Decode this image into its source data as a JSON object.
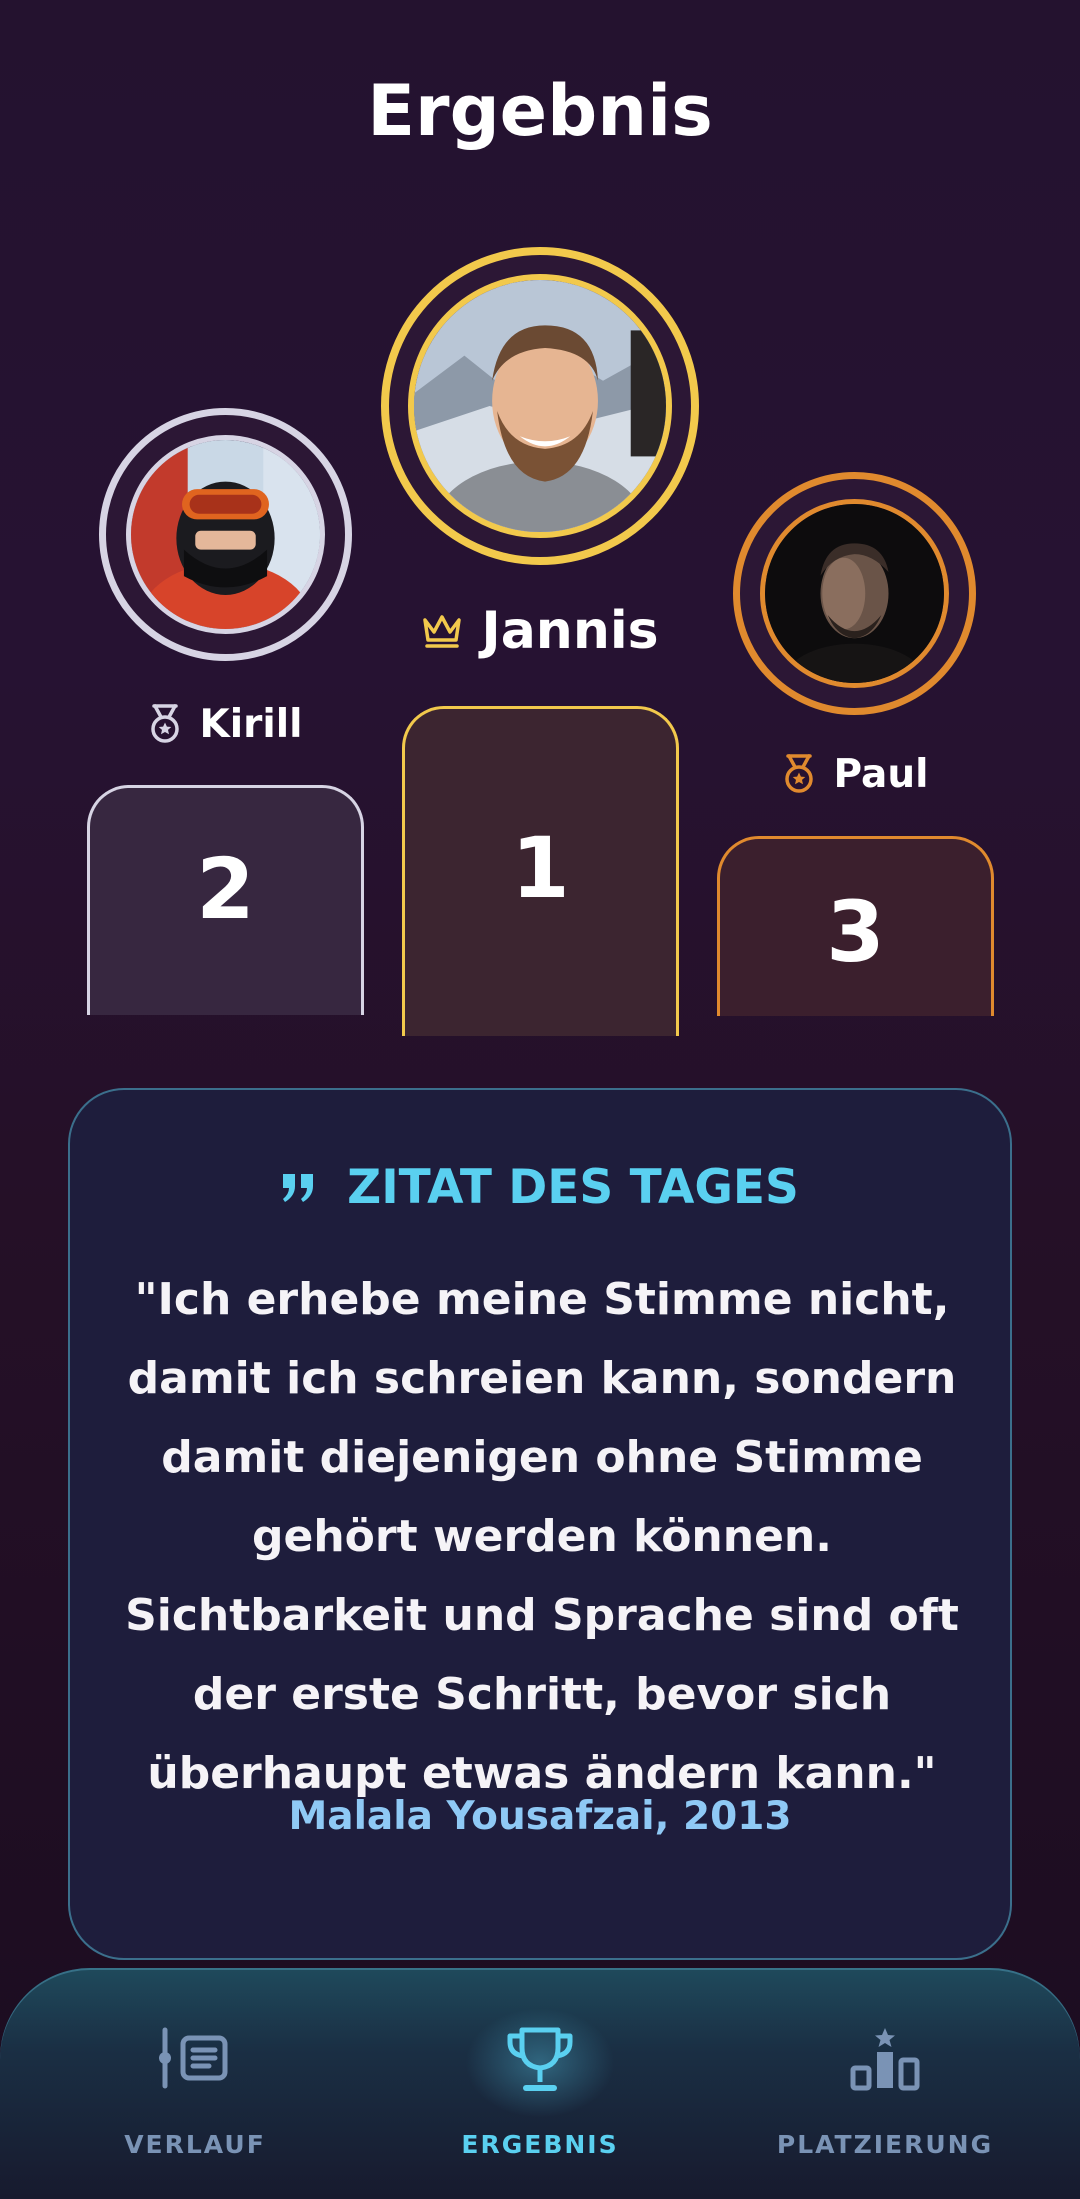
{
  "header": {
    "title": "Ergebnis"
  },
  "podium": {
    "first": {
      "place": "1",
      "name": "Jannis",
      "badge_icon": "crown-icon",
      "color": "#f2c94c"
    },
    "second": {
      "place": "2",
      "name": "Kirill",
      "badge_icon": "medal-icon",
      "color": "#d7d4e4"
    },
    "third": {
      "place": "3",
      "name": "Paul",
      "badge_icon": "medal-icon",
      "color": "#e08a2e"
    }
  },
  "quote": {
    "icon": "quote-icon",
    "heading": "ZITAT DES TAGES",
    "text": "\"Ich erhebe meine Stimme nicht, damit ich schreien kann, sondern damit diejenigen ohne Stimme gehört werden können. Sichtbarkeit und Sprache sind oft der erste Schritt, bevor sich überhaupt etwas ändern kann.\"",
    "author": "Malala Yousafzai, 2013"
  },
  "nav": {
    "items": [
      {
        "label": "VERLAUF",
        "icon": "history-list-icon",
        "active": false
      },
      {
        "label": "ERGEBNIS",
        "icon": "trophy-icon",
        "active": true
      },
      {
        "label": "PLATZIERUNG",
        "icon": "podium-icon",
        "active": false
      }
    ]
  },
  "colors": {
    "accent": "#5ad0f0",
    "gold": "#f2c94c",
    "silver": "#d7d4e4",
    "bronze": "#e08a2e",
    "background": "#24122f"
  }
}
